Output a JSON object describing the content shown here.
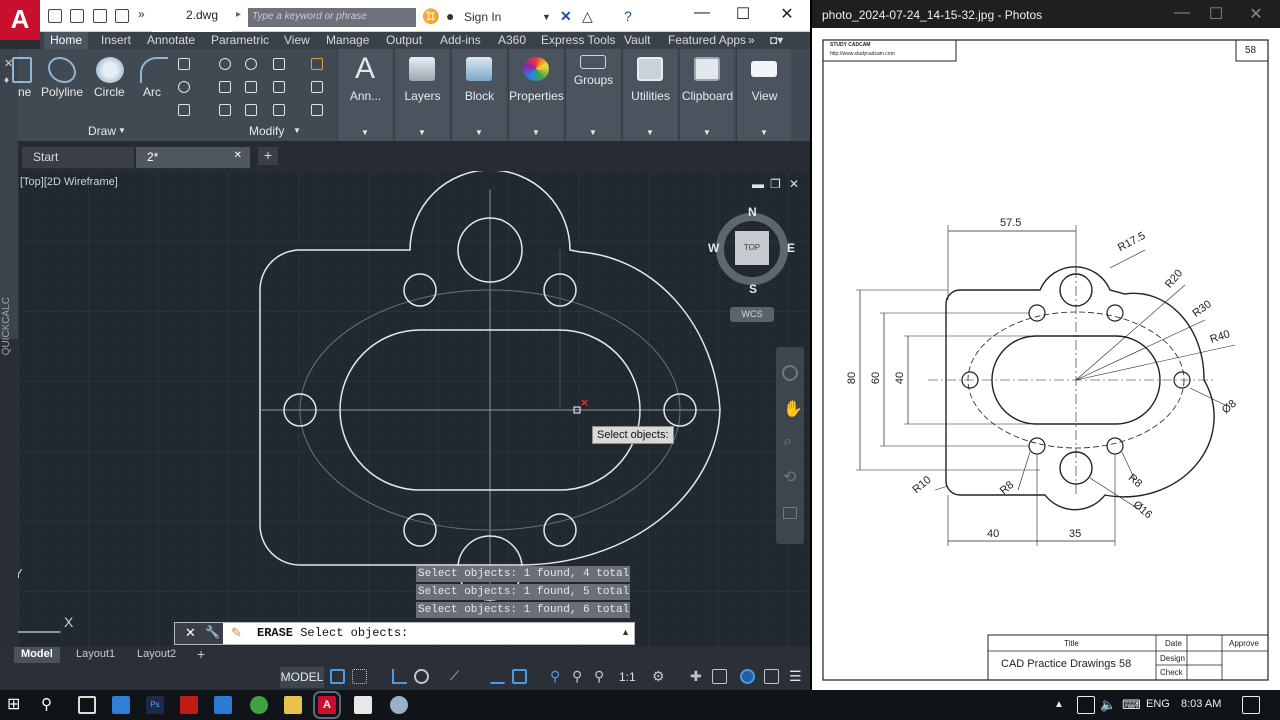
{
  "autocad": {
    "app_logo": "A",
    "doc_title": "2.dwg",
    "search_placeholder": "Type a keyword or phrase",
    "sign_in": "Sign In",
    "ribbon_tabs": [
      "Home",
      "Insert",
      "Annotate",
      "Parametric",
      "View",
      "Manage",
      "Output",
      "Add-ins",
      "A360",
      "Express Tools",
      "Vault",
      "Featured Apps"
    ],
    "draw_tools": [
      "ne",
      "Polyline",
      "Circle",
      "Arc"
    ],
    "group_titles": {
      "draw": "Draw",
      "modify": "Modify"
    },
    "panels": [
      "Ann...",
      "Layers",
      "Block",
      "Properties",
      "Groups",
      "Utilities",
      "Clipboard",
      "View"
    ],
    "file_tabs": [
      "Start",
      "2*"
    ],
    "viewport_label": "[Top][2D Wireframe]",
    "quickcalc": "QUICKCALC",
    "viewcube": {
      "n": "N",
      "s": "S",
      "e": "E",
      "w": "W",
      "face": "TOP",
      "wcs": "WCS"
    },
    "tooltip": "Select objects:",
    "history": [
      "Select objects: 1 found, 4 total",
      "Select objects: 1 found, 5 total",
      "Select objects: 1 found, 6 total"
    ],
    "command": {
      "keyword": "ERASE",
      "prompt": "Select objects:"
    },
    "layout_tabs": [
      "Model",
      "Layout1",
      "Layout2"
    ],
    "ucs": {
      "x": "X",
      "y": "Y"
    },
    "status_model": "MODEL",
    "status_scale": "1:1"
  },
  "photos": {
    "title": "photo_2024-07-24_14-15-32.jpg - Photos",
    "header_company": "STUDY CADCAM",
    "header_url": "http://www.studycadcam.com",
    "sheet_number": "58",
    "dims": {
      "top": "57.5",
      "r175": "R17.5",
      "r20": "R20",
      "r30": "R30",
      "r40": "R40",
      "d8": "Ø8",
      "h80": "80",
      "h60": "60",
      "h40": "40",
      "r10": "R10",
      "r8a": "R8",
      "r8b": "R8",
      "d16": "Ø16",
      "b40": "40",
      "b35": "35"
    },
    "title_block": {
      "title_label": "Title",
      "date_label": "Date",
      "approve_label": "Approve",
      "design_label": "Design",
      "check_label": "Check",
      "title": "CAD Practice Drawings 58"
    }
  },
  "taskbar": {
    "lang": "ENG",
    "time": "8:03 AM"
  },
  "colors": {
    "autocad_red": "#c8102e",
    "viewport_bg": "#212830",
    "ribbon_bg": "#414a53"
  }
}
